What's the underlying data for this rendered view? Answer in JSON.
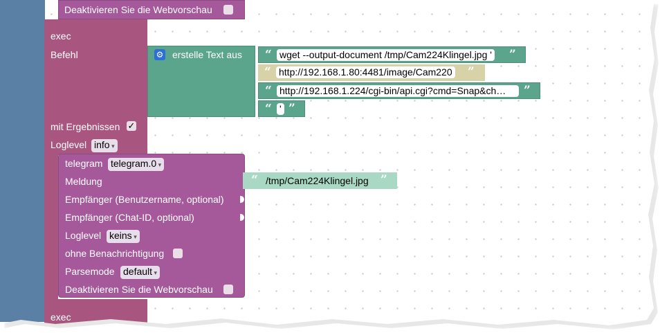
{
  "top_block": {
    "label": "Deaktivieren Sie die Webvorschau"
  },
  "exec_block": {
    "label": "exec",
    "befehl_label": "Befehl",
    "mit_ergebnissen_label": "mit Ergebnissen",
    "mit_ergebnissen_checked": "✓",
    "loglevel_label": "Loglevel",
    "loglevel_value": "info"
  },
  "text_join": {
    "label": "erstelle Text aus",
    "gear_icon": "⚙",
    "items": [
      "wget --output-document /tmp/Cam224Klingel.jpg '",
      "http://192.168.1.80:4481/image/Cam220",
      "http://192.168.1.224/cgi-bin/api.cgi?cmd=Snap&ch…",
      "'"
    ]
  },
  "telegram_block": {
    "label": "telegram",
    "instance": "telegram.0",
    "meldung_label": "Meldung",
    "meldung_value": "/tmp/Cam224Klingel.jpg",
    "empfaenger_user_label": "Empfänger (Benutzername, optional)",
    "empfaenger_chat_label": "Empfänger (Chat-ID, optional)",
    "loglevel_label": "Loglevel",
    "loglevel_value": "keins",
    "ohne_benachrichtigung_label": "ohne Benachrichtigung",
    "parsemode_label": "Parsemode",
    "parsemode_value": "default",
    "webvorschau_label": "Deaktivieren Sie die Webvorschau"
  },
  "bottom_block": {
    "label": "exec"
  },
  "quote_open": "“",
  "quote_close": "”",
  "colors": {
    "procedure_blue": "#5b80a5",
    "exec_purple": "#a8567f",
    "telegram_purple": "#a5599b",
    "text_green": "#5ba58c",
    "text_tan": "#d8d2a8"
  }
}
